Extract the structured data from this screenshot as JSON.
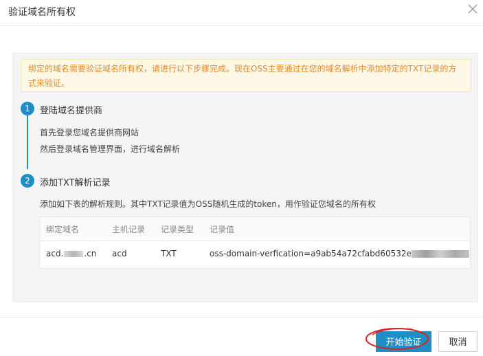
{
  "dialog": {
    "title": "验证域名所有权"
  },
  "notice": {
    "text": "绑定的域名需要验证域名所有权，请进行以下步骤完成。现在OSS主要通过在您的域名解析中添加特定的TXT记录的方式来验证。"
  },
  "steps": [
    {
      "number": "1",
      "title": "登陆域名提供商",
      "lines": [
        "首先登录您域名提供商网站",
        "然后登录域名管理界面，进行域名解析"
      ]
    },
    {
      "number": "2",
      "title": "添加TXT解析记录",
      "lines": [
        "添加如下表的解析规则。其中TXT记录值为OSS随机生成的token，用作验证您域名的所有权"
      ]
    }
  ],
  "table": {
    "headers": [
      "绑定域名",
      "主机记录",
      "记录类型",
      "记录值"
    ],
    "row": {
      "domain_prefix": "acd.",
      "domain_suffix": ".cn",
      "host": "acd",
      "type": "TXT",
      "value": "oss-domain-verfication=a9ab54a72cfabd60532e"
    }
  },
  "footer": {
    "start_label": "开始验证",
    "cancel_label": "取消"
  },
  "colors": {
    "primary": "#1e8fc6",
    "notice_text": "#e28a2b",
    "notice_bg": "#fdf8e6",
    "annotation": "#e02020"
  },
  "icons": {
    "close": "close-icon"
  }
}
